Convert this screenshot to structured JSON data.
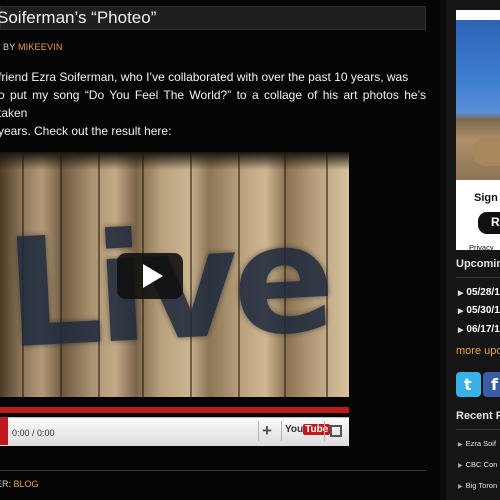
{
  "post": {
    "title": "Soiferman’s “Photeo”",
    "byline_prefix": "BY",
    "author": "MIKEEVIN",
    "body": [
      "friend Ezra Soiferman, who I’ve collaborated with over the past 10 years, was",
      "o put my song “Do You Feel The World?” to a collage of his art photos he’s taken",
      "years. Check out the result here:"
    ],
    "footer_prefix": "ER:",
    "category": "BLOG"
  },
  "video": {
    "graffiti_text": "Live",
    "time": "0:00 / 0:00",
    "plus_icon": "+",
    "youtube_you": "You",
    "youtube_tube": "Tube",
    "progress": 0,
    "colors": {
      "bar": "#c0191c"
    }
  },
  "sidebar": {
    "sign_label": "Sign",
    "sign_button": "R",
    "privacy": "Privacy",
    "upcoming_heading": "Upcomin",
    "events": [
      "05/28/1",
      "05/30/1",
      "06/17/1"
    ],
    "more_link": "more upc",
    "social": [
      {
        "name": "twitter-icon",
        "glyph": "t",
        "color": "#3ab0e8"
      },
      {
        "name": "facebook-icon",
        "glyph": "f",
        "color": "#3b5ba5"
      }
    ],
    "recent_heading": "Recent P",
    "recent_posts": [
      "Ezra Soif",
      "CBC Con",
      "Big Toron"
    ]
  },
  "colors": {
    "accent": "#e9a13b",
    "background": "#050505",
    "sidebar": "#151515"
  }
}
